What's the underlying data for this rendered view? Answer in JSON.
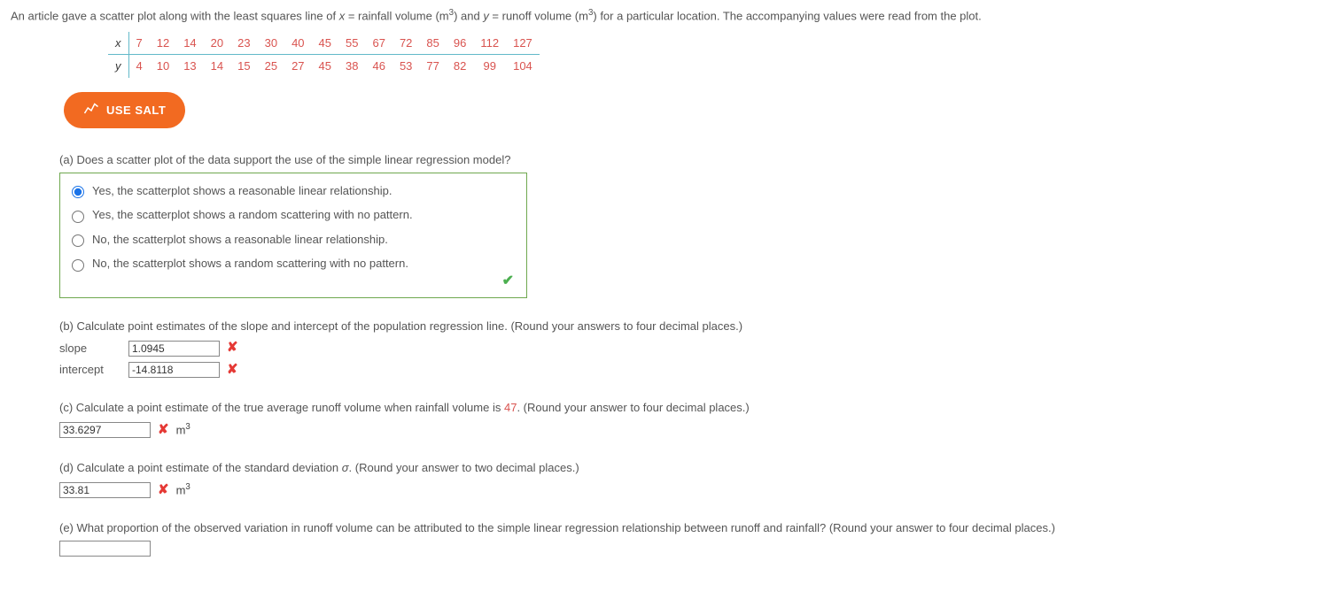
{
  "intro": {
    "pre": "An article gave a scatter plot along with the least squares line of ",
    "xv": "x",
    "eq1": " = rainfall volume (m",
    "sup": "3",
    "mid1": ") and ",
    "yv": "y",
    "eq2": " = runoff volume (m",
    "mid2": ") for a particular location. The accompanying values were read from the plot."
  },
  "table": {
    "xlabel": "x",
    "ylabel": "y",
    "x": [
      "7",
      "12",
      "14",
      "20",
      "23",
      "30",
      "40",
      "45",
      "55",
      "67",
      "72",
      "85",
      "96",
      "112",
      "127"
    ],
    "y": [
      "4",
      "10",
      "13",
      "14",
      "15",
      "25",
      "27",
      "45",
      "38",
      "46",
      "53",
      "77",
      "82",
      "99",
      "104"
    ]
  },
  "salt_label": "USE SALT",
  "a": {
    "q": "(a) Does a scatter plot of the data support the use of the simple linear regression model?",
    "opts": [
      "Yes, the scatterplot shows a reasonable linear relationship.",
      "Yes, the scatterplot shows a random scattering with no pattern.",
      "No, the scatterplot shows a reasonable linear relationship.",
      "No, the scatterplot shows a random scattering with no pattern."
    ]
  },
  "b": {
    "q": "(b) Calculate point estimates of the slope and intercept of the population regression line. (Round your answers to four decimal places.)",
    "slope_label": "slope",
    "slope_val": "1.0945",
    "intercept_label": "intercept",
    "intercept_val": "-14.8118"
  },
  "c": {
    "pre": "(c) Calculate a point estimate of the true average runoff volume when rainfall volume is ",
    "num": "47",
    "post": ". (Round your answer to four decimal places.)",
    "val": "33.6297",
    "unit_base": "m",
    "unit_sup": "3"
  },
  "d": {
    "pre": "(d) Calculate a point estimate of the standard deviation ",
    "sigma": "σ",
    "post": ". (Round your answer to two decimal places.)",
    "val": "33.81",
    "unit_base": "m",
    "unit_sup": "3"
  },
  "e": {
    "q": "(e) What proportion of the observed variation in runoff volume can be attributed to the simple linear regression relationship between runoff and rainfall? (Round your answer to four decimal places.)",
    "val": ""
  }
}
